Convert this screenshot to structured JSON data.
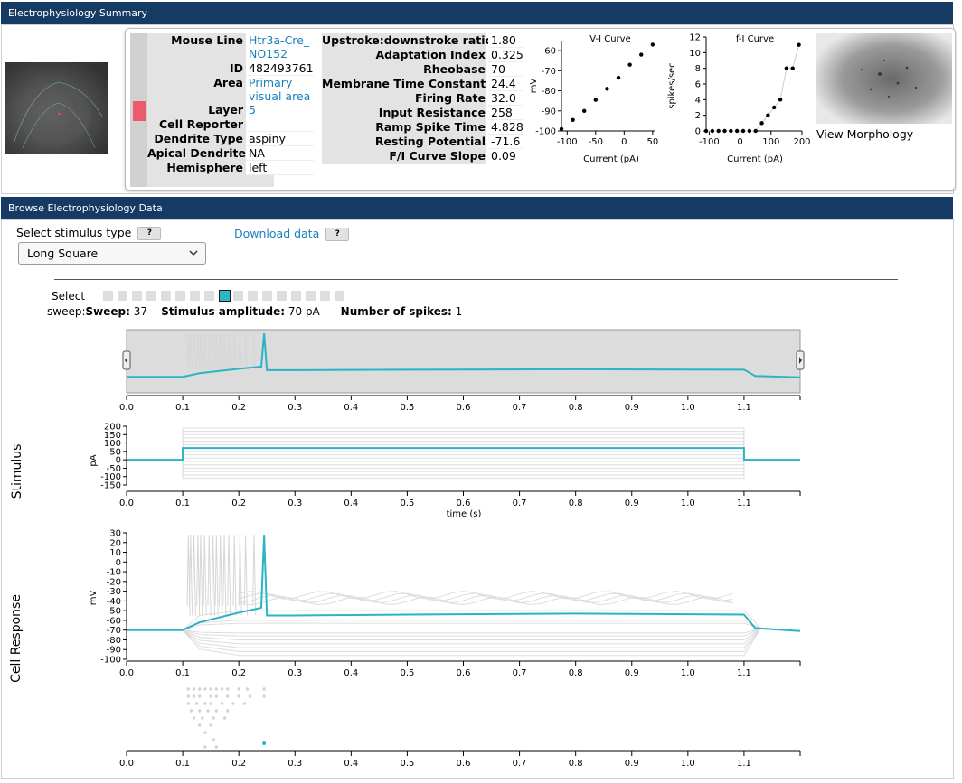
{
  "summary": {
    "header": "Electrophysiology Summary",
    "fields": [
      {
        "label": "Mouse Line",
        "value": "Htr3a-Cre_NO152",
        "link": true
      },
      {
        "label": "ID",
        "value": "482493761"
      },
      {
        "label": "Area",
        "value": "Primary visual area",
        "link": true
      },
      {
        "label": "Layer",
        "value": "5",
        "link": true
      },
      {
        "label": "Cell Reporter",
        "value": ""
      },
      {
        "label": "Dendrite Type",
        "value": "aspiny"
      },
      {
        "label": "Apical Dendrite",
        "value": "NA"
      },
      {
        "label": "Hemisphere",
        "value": "left"
      }
    ],
    "features": [
      {
        "label": "Upstroke:downstroke ratio",
        "value": "1.80"
      },
      {
        "label": "Adaptation Index",
        "value": "0.325"
      },
      {
        "label": "Rheobase",
        "value": "70"
      },
      {
        "label": "Membrane Time Constant",
        "value": "24.4"
      },
      {
        "label": "Firing Rate",
        "value": "32.0"
      },
      {
        "label": "Input Resistance",
        "value": "258"
      },
      {
        "label": "Ramp Spike Time",
        "value": "4.828"
      },
      {
        "label": "Resting Potential",
        "value": "-71.6"
      },
      {
        "label": "F/I Curve Slope",
        "value": "0.09"
      }
    ],
    "view_morphology": "View Morphology"
  },
  "browse": {
    "header": "Browse Electrophysiology Data",
    "stimulus_label": "Select stimulus type",
    "help": "?",
    "download": "Download data",
    "stimulus_selected": "Long Square",
    "select_label": "Select",
    "sweep_label": "sweep:",
    "info": {
      "sweep_key": "Sweep:",
      "sweep_val": "37",
      "amp_key": "Stimulus amplitude:",
      "amp_val": "70 pA",
      "spikes_key": "Number of spikes:",
      "spikes_val": "1"
    },
    "sweep_count": 17,
    "active_sweep_index": 8,
    "stimulus_title": "Stimulus",
    "response_title": "Cell Response"
  },
  "chart_data": [
    {
      "type": "scatter",
      "title": "V-I Curve",
      "xlabel": "Current (pA)",
      "ylabel": "mV",
      "xlim": [
        -110,
        55
      ],
      "ylim": [
        -100,
        -55
      ],
      "xticks": [
        "-100",
        "-50",
        "0",
        "50"
      ],
      "xtick_values": [
        -100,
        -50,
        0,
        50
      ],
      "yticks": [
        "-60",
        "-70",
        "-80",
        "-90",
        "-100"
      ],
      "ytick_values": [
        -60,
        -70,
        -80,
        -90,
        -100
      ],
      "x": [
        -110,
        -90,
        -70,
        -50,
        -30,
        -10,
        10,
        30,
        50
      ],
      "y": [
        -99,
        -94.5,
        -90,
        -84.5,
        -79,
        -73.5,
        -67,
        -62,
        -57
      ]
    },
    {
      "type": "line",
      "title": "f-I Curve",
      "xlabel": "Current (pA)",
      "ylabel": "spikes/sec",
      "xlim": [
        -110,
        200
      ],
      "ylim": [
        0,
        12
      ],
      "xticks": [
        "-100",
        "0",
        "100",
        "200"
      ],
      "xtick_values": [
        -100,
        0,
        100,
        200
      ],
      "yticks": [
        "0",
        "2",
        "4",
        "6",
        "8",
        "10",
        "12"
      ],
      "ytick_values": [
        0,
        2,
        4,
        6,
        8,
        10,
        12
      ],
      "x": [
        -110,
        -90,
        -70,
        -50,
        -30,
        -10,
        10,
        30,
        50,
        70,
        90,
        110,
        130,
        150,
        170,
        190
      ],
      "y": [
        0,
        0,
        0,
        0,
        0,
        0,
        0,
        0,
        0,
        1,
        2,
        3,
        4,
        8,
        8,
        11
      ]
    },
    {
      "type": "line",
      "title": "",
      "xlabel": "",
      "ylabel": "",
      "xlim": [
        0,
        1.2
      ],
      "ylim": [
        -100,
        30
      ],
      "xticks": [
        "0.0",
        "0.1",
        "0.2",
        "0.3",
        "0.4",
        "0.5",
        "0.6",
        "0.7",
        "0.8",
        "0.9",
        "1.0",
        "1.1"
      ],
      "xtick_values": [
        0,
        0.1,
        0.2,
        0.3,
        0.4,
        0.5,
        0.6,
        0.7,
        0.8,
        0.9,
        1.0,
        1.1
      ],
      "active_color": "#2bb5c4",
      "x": [
        0,
        0.1,
        0.13,
        0.2,
        0.24,
        0.245,
        0.25,
        0.3,
        0.5,
        0.8,
        1.1,
        1.12,
        1.2
      ],
      "y": [
        -70,
        -70,
        -62,
        -52,
        -47,
        28,
        -55,
        -55,
        -54,
        -53,
        -54,
        -68,
        -71
      ]
    },
    {
      "type": "line",
      "title": "",
      "xlabel": "time (s)",
      "ylabel": "pA",
      "xlim": [
        0,
        1.2
      ],
      "ylim": [
        -150,
        200
      ],
      "xticks": [
        "0.0",
        "0.1",
        "0.2",
        "0.3",
        "0.4",
        "0.5",
        "0.6",
        "0.7",
        "0.8",
        "0.9",
        "1.0",
        "1.1"
      ],
      "xtick_values": [
        0,
        0.1,
        0.2,
        0.3,
        0.4,
        0.5,
        0.6,
        0.7,
        0.8,
        0.9,
        1.0,
        1.1
      ],
      "yticks": [
        "200",
        "150",
        "100",
        "50",
        "0",
        "-50",
        "-100",
        "-150"
      ],
      "ytick_values": [
        200,
        150,
        100,
        50,
        0,
        -50,
        -100,
        -150
      ],
      "active_color": "#2bb5c4",
      "x": [
        0,
        0.1,
        0.1,
        1.1,
        1.1,
        1.2
      ],
      "y": [
        0,
        0,
        70,
        70,
        0,
        0
      ],
      "series": [
        {
          "values": [
            -110,
            -90,
            -70,
            -50,
            -30,
            -10,
            10,
            30,
            50,
            90,
            110,
            130,
            150,
            170,
            190
          ]
        }
      ]
    },
    {
      "type": "line",
      "title": "",
      "xlabel": "",
      "ylabel": "mV",
      "xlim": [
        0,
        1.2
      ],
      "ylim": [
        -100,
        30
      ],
      "xticks": [
        "0.0",
        "0.1",
        "0.2",
        "0.3",
        "0.4",
        "0.5",
        "0.6",
        "0.7",
        "0.8",
        "0.9",
        "1.0",
        "1.1"
      ],
      "xtick_values": [
        0,
        0.1,
        0.2,
        0.3,
        0.4,
        0.5,
        0.6,
        0.7,
        0.8,
        0.9,
        1.0,
        1.1
      ],
      "yticks": [
        "30",
        "20",
        "10",
        "0",
        "-10",
        "-20",
        "-30",
        "-40",
        "-50",
        "-60",
        "-70",
        "-80",
        "-90",
        "-100"
      ],
      "ytick_values": [
        30,
        20,
        10,
        0,
        -10,
        -20,
        -30,
        -40,
        -50,
        -60,
        -70,
        -80,
        -90,
        -100
      ],
      "active_color": "#2bb5c4",
      "x": [
        0,
        0.1,
        0.13,
        0.2,
        0.24,
        0.245,
        0.25,
        0.3,
        0.5,
        0.8,
        1.1,
        1.12,
        1.2
      ],
      "y": [
        -70,
        -70,
        -62,
        -52,
        -47,
        28,
        -55,
        -55,
        -54,
        -53,
        -54,
        -68,
        -71
      ],
      "series": [
        {
          "values": [
            -96,
            -92,
            -88,
            -84,
            -80,
            -76,
            -73,
            -63,
            -60,
            -50
          ]
        }
      ]
    },
    {
      "type": "scatter",
      "title": "",
      "xlabel": "",
      "ylabel": "",
      "xlim": [
        0,
        1.2
      ],
      "xticks": [
        "0.0",
        "0.1",
        "0.2",
        "0.3",
        "0.4",
        "0.5",
        "0.6",
        "0.7",
        "0.8",
        "0.9",
        "1.0",
        "1.1"
      ],
      "xtick_values": [
        0,
        0.1,
        0.2,
        0.3,
        0.4,
        0.5,
        0.6,
        0.7,
        0.8,
        0.9,
        1.0,
        1.1
      ],
      "active_color": "#2bb5c4",
      "active_spike_time": 0.245,
      "rows": [
        [
          0.11,
          0.12,
          0.13,
          0.14,
          0.15,
          0.16,
          0.17,
          0.18,
          0.2,
          0.215,
          0.245
        ],
        [
          0.11,
          0.12,
          0.13,
          0.15,
          0.16,
          0.18,
          0.2,
          0.22,
          0.245
        ],
        [
          0.11,
          0.125,
          0.14,
          0.15,
          0.17,
          0.19,
          0.21
        ],
        [
          0.115,
          0.13,
          0.145,
          0.16,
          0.18
        ],
        [
          0.12,
          0.135,
          0.155,
          0.175
        ],
        [
          0.13,
          0.15
        ],
        [
          0.14
        ],
        [
          0.155
        ],
        [
          0.14,
          0.16
        ]
      ]
    }
  ]
}
